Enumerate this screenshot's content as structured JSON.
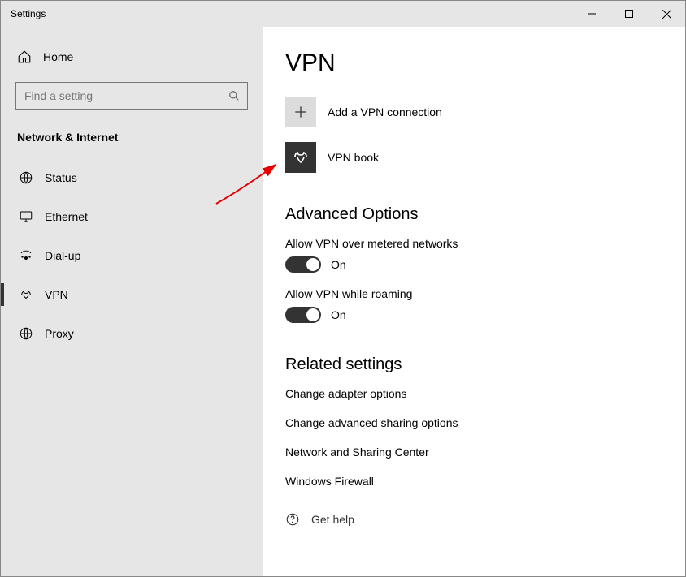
{
  "window": {
    "title": "Settings"
  },
  "sidebar": {
    "home": "Home",
    "search_placeholder": "Find a setting",
    "section": "Network & Internet",
    "items": [
      {
        "label": "Status"
      },
      {
        "label": "Ethernet"
      },
      {
        "label": "Dial-up"
      },
      {
        "label": "VPN"
      },
      {
        "label": "Proxy"
      }
    ]
  },
  "main": {
    "title": "VPN",
    "add_label": "Add a VPN connection",
    "connection_label": "VPN book",
    "advanced_heading": "Advanced Options",
    "metered_label": "Allow VPN over metered networks",
    "metered_state": "On",
    "roaming_label": "Allow VPN while roaming",
    "roaming_state": "On",
    "related_heading": "Related settings",
    "links": [
      "Change adapter options",
      "Change advanced sharing options",
      "Network and Sharing Center",
      "Windows Firewall"
    ],
    "help_label": "Get help"
  }
}
